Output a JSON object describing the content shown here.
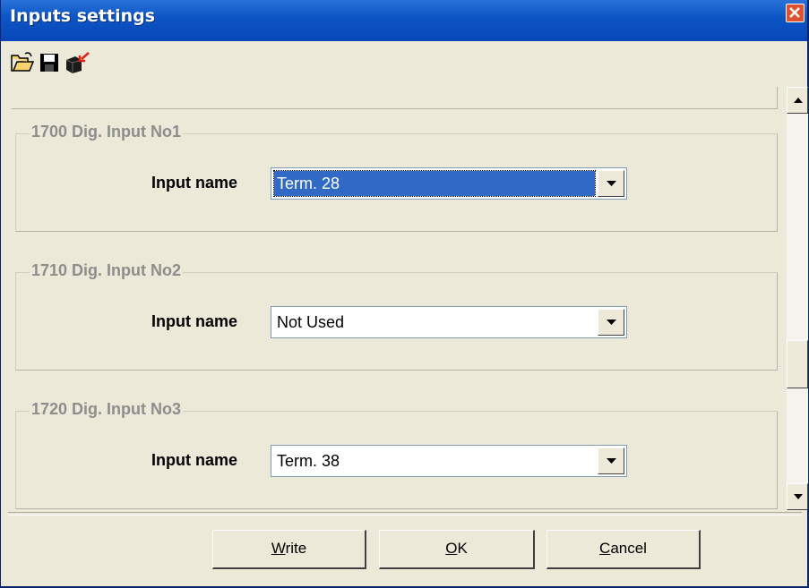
{
  "window": {
    "title": "Inputs settings"
  },
  "toolbar": {
    "icons": [
      "open-folder-icon",
      "save-disk-icon",
      "read-device-icon"
    ]
  },
  "groups": [
    {
      "title": "1700 Dig. Input No1",
      "label": "Input name",
      "value": "Term. 28",
      "selected": true
    },
    {
      "title": "1710 Dig. Input No2",
      "label": "Input name",
      "value": "Not Used",
      "selected": false
    },
    {
      "title": "1720 Dig. Input No3",
      "label": "Input name",
      "value": "Term. 38",
      "selected": false
    }
  ],
  "buttons": {
    "write": {
      "mnemonic": "W",
      "rest": "rite"
    },
    "ok": {
      "mnemonic": "O",
      "rest": "K"
    },
    "cancel": {
      "mnemonic": "C",
      "rest": "ancel"
    }
  },
  "colors": {
    "titlebar": "#0d56c5",
    "selection": "#316ac5",
    "background": "#ece9d8",
    "close": "#e0522f"
  }
}
